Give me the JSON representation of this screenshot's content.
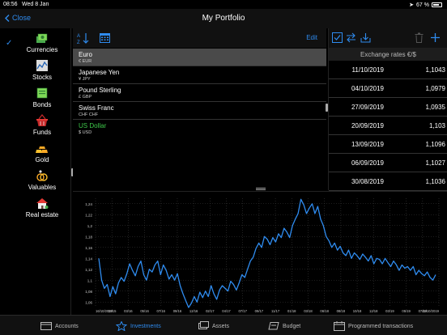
{
  "status": {
    "time": "08:56",
    "date": "Wed 8 Jan",
    "battery": "67 %"
  },
  "nav": {
    "close": "Close",
    "title": "My Portfolio"
  },
  "categories": [
    {
      "label": "Currencies",
      "icon": "currencies-icon",
      "selected": true
    },
    {
      "label": "Stocks",
      "icon": "stocks-icon"
    },
    {
      "label": "Bonds",
      "icon": "bonds-icon"
    },
    {
      "label": "Funds",
      "icon": "funds-basket-icon"
    },
    {
      "label": "Gold",
      "icon": "gold-bars-icon"
    },
    {
      "label": "Valuables",
      "icon": "rings-icon"
    },
    {
      "label": "Real estate",
      "icon": "house-icon"
    }
  ],
  "assets": {
    "edit": "Edit",
    "items": [
      {
        "name": "Euro",
        "code": "€ EUR",
        "selected": true
      },
      {
        "name": "Japanese Yen",
        "code": "¥ JPY"
      },
      {
        "name": "Pound Sterling",
        "code": "£ GBP"
      },
      {
        "name": "Swiss Franc",
        "code": "CHF CHF"
      },
      {
        "name": "US Dollar",
        "code": "$ USD",
        "color": "#3ec94a"
      }
    ]
  },
  "rates": {
    "header": "Exchange rates €/$",
    "rows": [
      {
        "date": "11/10/2019",
        "value": "1,1043"
      },
      {
        "date": "04/10/2019",
        "value": "1,0979"
      },
      {
        "date": "27/09/2019",
        "value": "1,0935"
      },
      {
        "date": "20/09/2019",
        "value": "1,103"
      },
      {
        "date": "13/09/2019",
        "value": "1,1096"
      },
      {
        "date": "06/09/2019",
        "value": "1,1027"
      },
      {
        "date": "30/08/2019",
        "value": "1,1036"
      }
    ]
  },
  "chart_data": {
    "type": "line",
    "title": "",
    "xlabel": "",
    "ylabel": "",
    "ylim": [
      1.05,
      1.25
    ],
    "yticks": [
      "1,06",
      "1,08",
      "1,1",
      "1,12",
      "1,14",
      "1,16",
      "1,18",
      "1,2",
      "1,22",
      "1,24"
    ],
    "xticks": [
      "16/10/2019",
      "12/15",
      "03/16",
      "05/16",
      "07/16",
      "09/16",
      "12/16",
      "02/17",
      "04/17",
      "07/17",
      "09/17",
      "11/17",
      "01/18",
      "03/18",
      "06/18",
      "08/18",
      "10/18",
      "12/18",
      "03/19",
      "05/19",
      "07/19",
      "11/10/2019"
    ],
    "grid": true,
    "color": "#2f8cf0",
    "series": [
      {
        "values": [
          1.14,
          1.1,
          1.085,
          1.092,
          1.07,
          1.088,
          1.075,
          1.095,
          1.105,
          1.098,
          1.112,
          1.13,
          1.118,
          1.108,
          1.125,
          1.135,
          1.11,
          1.1,
          1.12,
          1.115,
          1.128,
          1.135,
          1.11,
          1.128,
          1.118,
          1.102,
          1.11,
          1.1,
          1.112,
          1.09,
          1.075,
          1.062,
          1.05,
          1.058,
          1.07,
          1.06,
          1.078,
          1.068,
          1.08,
          1.07,
          1.09,
          1.075,
          1.065,
          1.082,
          1.09,
          1.085,
          1.08,
          1.098,
          1.092,
          1.082,
          1.095,
          1.11,
          1.105,
          1.12,
          1.135,
          1.142,
          1.158,
          1.168,
          1.16,
          1.18,
          1.175,
          1.165,
          1.178,
          1.17,
          1.185,
          1.178,
          1.195,
          1.188,
          1.178,
          1.2,
          1.212,
          1.222,
          1.248,
          1.238,
          1.222,
          1.232,
          1.24,
          1.222,
          1.235,
          1.212,
          1.2,
          1.18,
          1.172,
          1.16,
          1.168,
          1.155,
          1.162,
          1.15,
          1.145,
          1.155,
          1.14,
          1.15,
          1.145,
          1.138,
          1.148,
          1.142,
          1.135,
          1.145,
          1.13,
          1.14,
          1.138,
          1.13,
          1.14,
          1.132,
          1.125,
          1.135,
          1.128,
          1.118,
          1.128,
          1.122,
          1.125,
          1.118,
          1.125,
          1.11,
          1.118,
          1.112,
          1.108,
          1.115,
          1.105,
          1.1,
          1.11
        ]
      }
    ]
  },
  "tabs": [
    {
      "label": "Accounts",
      "icon": "accounts-icon"
    },
    {
      "label": "Investments",
      "icon": "investments-icon",
      "active": true
    },
    {
      "label": "Assets",
      "icon": "assets-icon"
    },
    {
      "label": "Budget",
      "icon": "budget-icon"
    },
    {
      "label": "Programmed transactions",
      "icon": "calendar-icon"
    }
  ]
}
